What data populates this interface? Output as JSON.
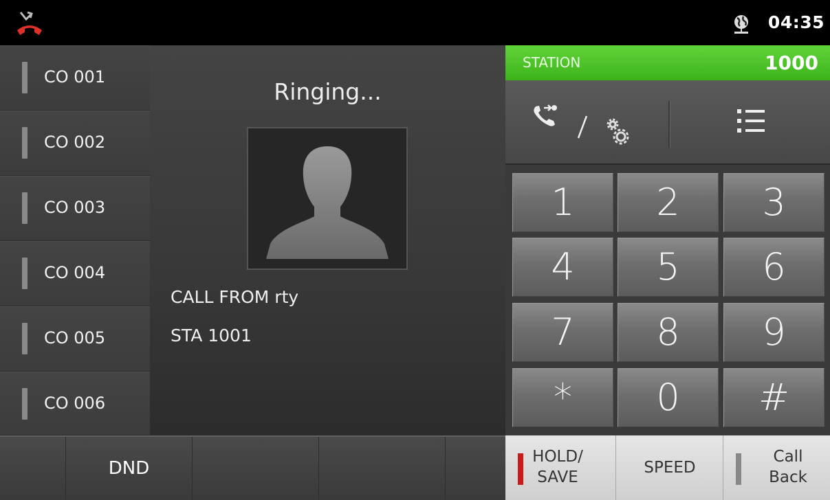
{
  "status_bar": {
    "missed_call_icon": "missed-call-icon",
    "globe_icon": "globe-icon",
    "time": "04:35"
  },
  "co_lines": [
    {
      "label": "CO 001"
    },
    {
      "label": "CO 002"
    },
    {
      "label": "CO 003"
    },
    {
      "label": "CO 004"
    },
    {
      "label": "CO 005"
    },
    {
      "label": "CO 006"
    }
  ],
  "call": {
    "status": "Ringing...",
    "caller_line1": "CALL FROM rty",
    "caller_line2": "STA 1001"
  },
  "station": {
    "label": "STATION",
    "number": "1000",
    "accent_color": "#4cc42a"
  },
  "keypad": {
    "keys": [
      "1",
      "2",
      "3",
      "4",
      "5",
      "6",
      "7",
      "8",
      "9",
      "*",
      "0",
      "#"
    ]
  },
  "bottom_bar": {
    "dnd_label": "DND",
    "hold_save_line1": "HOLD/",
    "hold_save_line2": "SAVE",
    "hold_led_color": "#cc1a1a",
    "speed_label": "SPEED",
    "call_back_line1": "Call",
    "call_back_line2": "Back"
  }
}
